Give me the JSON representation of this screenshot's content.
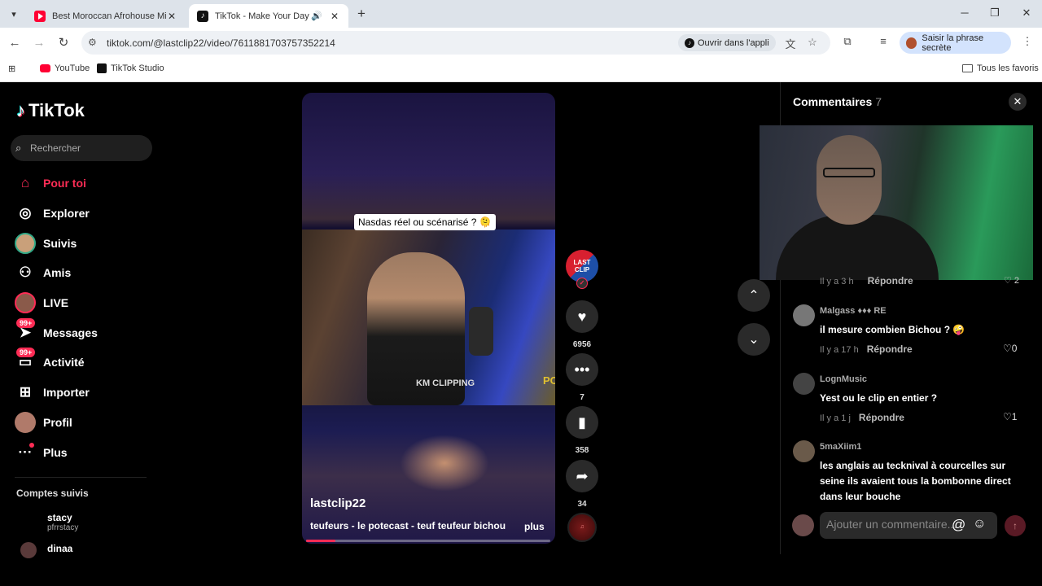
{
  "browser": {
    "tabs": [
      {
        "title": "Best Moroccan Afrohouse Mix",
        "favicon": "youtube-icon"
      },
      {
        "title": "TikTok - Make Your Day",
        "favicon": "tiktok-icon",
        "audio": "🔊"
      }
    ],
    "url": "tiktok.com/@lastclip22/video/7611881703757352214",
    "open_app_label": "Ouvrir dans l'appli",
    "passphrase_label": "Saisir la phrase secrète",
    "bookmarks": [
      {
        "label": "YouTube"
      },
      {
        "label": "TikTok Studio"
      }
    ],
    "all_favorites": "Tous les favoris"
  },
  "tiktok": {
    "logo": "TikTok",
    "search_placeholder": "Rechercher",
    "nav": [
      {
        "label": "Pour toi",
        "icon": "home-icon"
      },
      {
        "label": "Explorer",
        "icon": "compass-icon"
      },
      {
        "label": "Suivis",
        "icon": "avatar-icon"
      },
      {
        "label": "Amis",
        "icon": "friends-icon"
      },
      {
        "label": "LIVE",
        "icon": "live-icon"
      },
      {
        "label": "Messages",
        "icon": "messages-icon",
        "badge": "99+"
      },
      {
        "label": "Activité",
        "icon": "activity-icon",
        "badge": "99+"
      },
      {
        "label": "Importer",
        "icon": "upload-icon"
      },
      {
        "label": "Profil",
        "icon": "profile-icon"
      },
      {
        "label": "Plus",
        "icon": "more-icon"
      }
    ],
    "followed_title": "Comptes suivis",
    "followed": [
      {
        "name": "stacy",
        "handle": "pfrrstacy"
      },
      {
        "name": "dinaa",
        "handle": ""
      }
    ]
  },
  "video": {
    "caption": "Nasdas réel ou scénarisé ? 🫠",
    "watermark": "KM CLIPPING",
    "author": "lastclip22",
    "description": "teufeurs - le potecast - teuf teufeur bichou",
    "more": "plus",
    "progress_fraction": 0.12,
    "avatar_text": "LAST CLIP",
    "likes": "6956",
    "comments": "7",
    "saves": "358",
    "shares": "34"
  },
  "comments": {
    "title": "Commentaires",
    "count": "7",
    "partial_meta": {
      "time": "Il y a 3 h",
      "reply": "Répondre",
      "likes": "2"
    },
    "items": [
      {
        "user": "Malgass ♦♦♦ RE",
        "text": "il mesure combien Bichou ? 🤪",
        "time": "Il y a 17 h",
        "reply": "Répondre",
        "likes": "0"
      },
      {
        "user": "LognMusic",
        "text": "Yest ou le clip en entier ?",
        "time": "Il y a 1 j",
        "reply": "Répondre",
        "likes": "1"
      },
      {
        "user": "5maXiim1",
        "text": "les anglais au tecknival à courcelles sur seine ils avaient tous la bombonne direct dans leur bouche",
        "time": "",
        "reply": "",
        "likes": ""
      }
    ],
    "input_placeholder": "Ajouter un commentaire..."
  }
}
